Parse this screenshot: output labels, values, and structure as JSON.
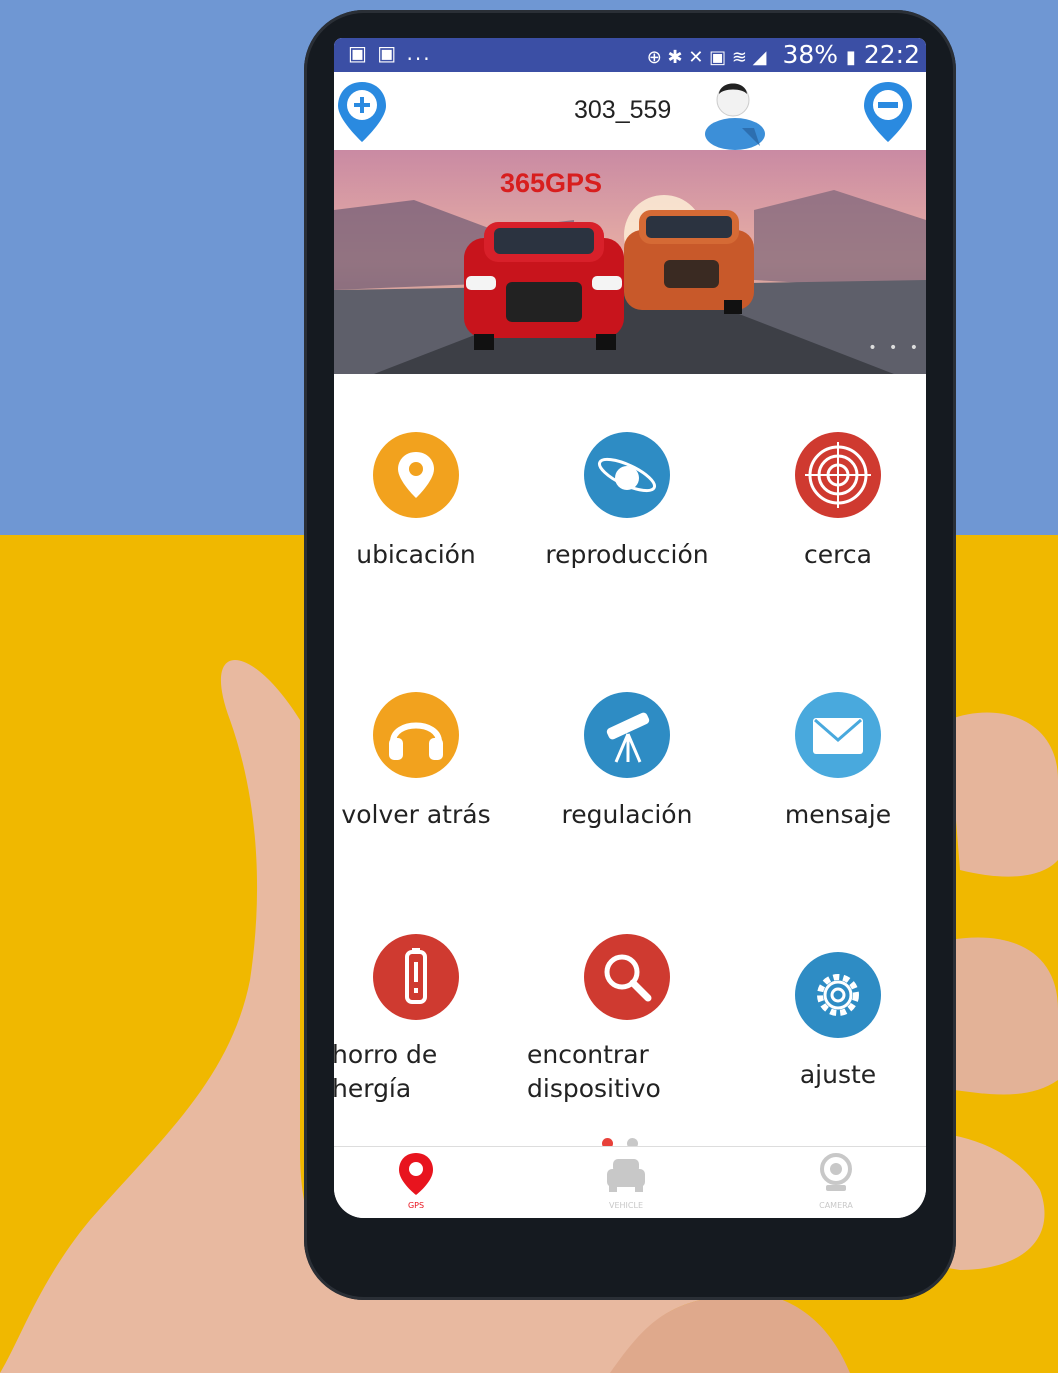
{
  "status_bar": {
    "left_icons": "▣ ▣ ...",
    "battery": "38%",
    "time": "22:2"
  },
  "header": {
    "device_name": "303_559"
  },
  "banner": {
    "title": "365GPS"
  },
  "menu": [
    {
      "label": "ubicación",
      "icon": "location-pin-icon",
      "color": "#f2a21e"
    },
    {
      "label": "reproducción",
      "icon": "planet-orbit-icon",
      "color": "#2e8cc4"
    },
    {
      "label": "cerca",
      "icon": "target-icon",
      "color": "#cf3a30"
    },
    {
      "label": "volver atrás",
      "icon": "headphones-icon",
      "color": "#f2a21e"
    },
    {
      "label": "regulación",
      "icon": "telescope-icon",
      "color": "#2e8cc4"
    },
    {
      "label": "mensaje",
      "icon": "envelope-icon",
      "color": "#49a9dd"
    },
    {
      "label": "horro de\nhergía",
      "label_line1": "horro de",
      "label_line2": "hergía",
      "icon": "battery-alert-icon",
      "color": "#cf3a30"
    },
    {
      "label_line1": "encontrar",
      "label_line2": "dispositivo",
      "icon": "magnifier-icon",
      "color": "#cf3a30"
    },
    {
      "label": "ajuste",
      "icon": "gear-icon",
      "color": "#2e8cc4"
    }
  ],
  "pager": {
    "active_color": "#e8413a",
    "inactive_color": "#c8c8c8"
  },
  "tabs": [
    {
      "label": "GPS",
      "active": true,
      "icon": "location-pin-icon",
      "color": "#e8141e"
    },
    {
      "label": "VEHICLE",
      "active": false,
      "icon": "car-icon",
      "color": "#c8c8c8"
    },
    {
      "label": "CAMERA",
      "active": false,
      "icon": "camera-icon",
      "color": "#c8c8c8"
    }
  ]
}
